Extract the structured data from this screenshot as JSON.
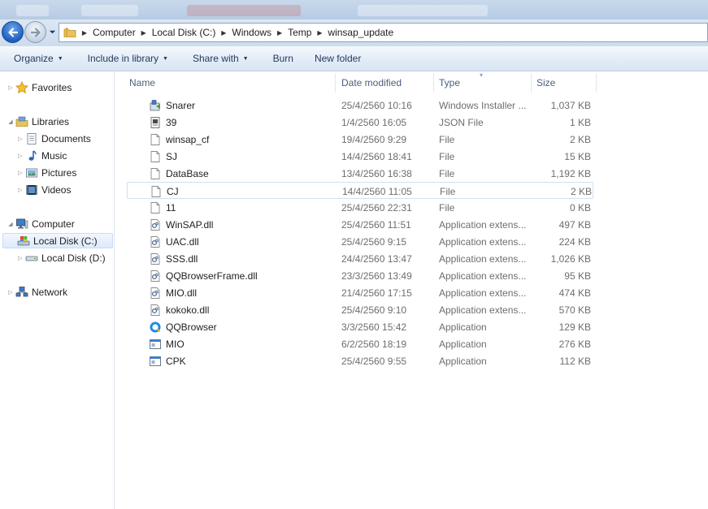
{
  "address": {
    "crumbs": [
      "Computer",
      "Local Disk (C:)",
      "Windows",
      "Temp",
      "winsap_update"
    ]
  },
  "toolbar": {
    "organize": "Organize",
    "include_in_library": "Include in library",
    "share_with": "Share with",
    "burn": "Burn",
    "new_folder": "New folder"
  },
  "nav": {
    "favorites": "Favorites",
    "libraries": "Libraries",
    "documents": "Documents",
    "music": "Music",
    "pictures": "Pictures",
    "videos": "Videos",
    "computer": "Computer",
    "local_c": "Local Disk (C:)",
    "local_d": "Local Disk (D:)",
    "network": "Network"
  },
  "columns": {
    "name": "Name",
    "date": "Date modified",
    "type": "Type",
    "size": "Size"
  },
  "files": [
    {
      "name": "Snarer",
      "date": "25/4/2560 10:16",
      "type": "Windows Installer ...",
      "size": "1,037 KB",
      "icon": "installer-icon"
    },
    {
      "name": "39",
      "date": "1/4/2560 16:05",
      "type": "JSON File",
      "size": "1 KB",
      "icon": "json-file-icon"
    },
    {
      "name": "winsap_cf",
      "date": "19/4/2560 9:29",
      "type": "File",
      "size": "2 KB",
      "icon": "file-icon"
    },
    {
      "name": "SJ",
      "date": "14/4/2560 18:41",
      "type": "File",
      "size": "15 KB",
      "icon": "file-icon"
    },
    {
      "name": "DataBase",
      "date": "13/4/2560 16:38",
      "type": "File",
      "size": "1,192 KB",
      "icon": "file-icon"
    },
    {
      "name": "CJ",
      "date": "14/4/2560 11:05",
      "type": "File",
      "size": "2 KB",
      "icon": "file-icon"
    },
    {
      "name": "11",
      "date": "25/4/2560 22:31",
      "type": "File",
      "size": "0 KB",
      "icon": "file-icon"
    },
    {
      "name": "WinSAP.dll",
      "date": "25/4/2560 11:51",
      "type": "Application extens...",
      "size": "497 KB",
      "icon": "dll-icon"
    },
    {
      "name": "UAC.dll",
      "date": "25/4/2560 9:15",
      "type": "Application extens...",
      "size": "224 KB",
      "icon": "dll-icon"
    },
    {
      "name": "SSS.dll",
      "date": "24/4/2560 13:47",
      "type": "Application extens...",
      "size": "1,026 KB",
      "icon": "dll-icon"
    },
    {
      "name": "QQBrowserFrame.dll",
      "date": "23/3/2560 13:49",
      "type": "Application extens...",
      "size": "95 KB",
      "icon": "dll-icon"
    },
    {
      "name": "MIO.dll",
      "date": "21/4/2560 17:15",
      "type": "Application extens...",
      "size": "474 KB",
      "icon": "dll-icon"
    },
    {
      "name": "kokoko.dll",
      "date": "25/4/2560 9:10",
      "type": "Application extens...",
      "size": "570 KB",
      "icon": "dll-icon"
    },
    {
      "name": "QQBrowser",
      "date": "3/3/2560 15:42",
      "type": "Application",
      "size": "129 KB",
      "icon": "qqbrowser-icon"
    },
    {
      "name": "MIO",
      "date": "6/2/2560 18:19",
      "type": "Application",
      "size": "276 KB",
      "icon": "application-icon"
    },
    {
      "name": "CPK",
      "date": "25/4/2560 9:55",
      "type": "Application",
      "size": "112 KB",
      "icon": "application-icon"
    }
  ],
  "colors": {
    "accent": "#1e5fc2",
    "toolbar_text": "#1e395b",
    "secondary_text": "#6d6d6d"
  }
}
